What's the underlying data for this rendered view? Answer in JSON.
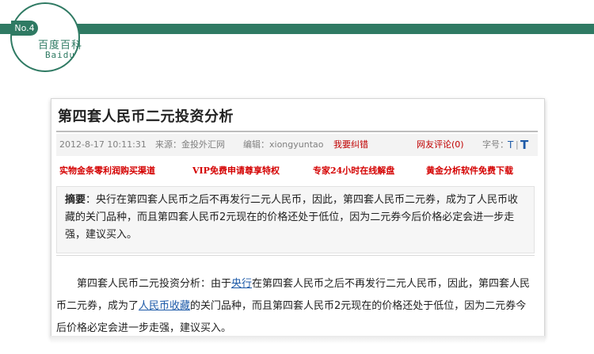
{
  "header": {
    "no_label": "No.4",
    "baike_cn": "百度百科",
    "baike_en": "Baidu"
  },
  "article": {
    "title": "第四套人民币二元投资分析",
    "meta": {
      "date": "2012-8-17 10:11:31",
      "source": "来源：金投外汇网",
      "editor": "编辑：xiongyuntao",
      "report": "我要纠错",
      "comments": "网友评论(0)",
      "font_size_label": "字号：",
      "font_small": "T",
      "font_sep": "|",
      "font_big": "T"
    },
    "promos": [
      "实物金条零利润购买渠道",
      "VIP免费申请尊享特权",
      "专家24小时在线解盘",
      "黄金分析软件免费下载"
    ],
    "summary": {
      "label": "摘要",
      "colon": "：",
      "text": "央行在第四套人民币之后不再发行二元人民币，因此，第四套人民币二元券，成为了人民币收藏的关门品种，而且第四套人民币2元现在的价格还处于低位，因为二元券今后价格必定会进一步走强，建议买入。"
    },
    "body": {
      "part1": "第四套人民币二元投资分析：由于",
      "link1": "央行",
      "part2": "在第四套人民币之后不再发行二元人民币，因此，第四套人民币二元券，成为了",
      "link2": "人民币收藏",
      "part3": "的关门品种，而且第四套人民币2元现在的价格还处于低位，因为二元券今后价格必定会进一步走强，建议买入。"
    }
  },
  "colors": {
    "brand_green": "#2f7a63",
    "link_blue": "#1d5aa8",
    "promo_red": "#d40000"
  }
}
